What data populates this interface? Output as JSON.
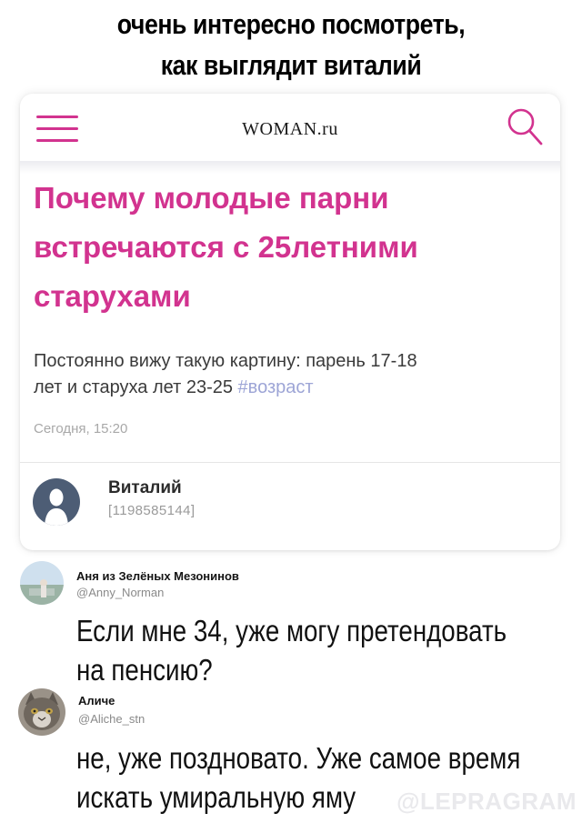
{
  "caption": {
    "line1": "очень интересно посмотреть,",
    "line2": "как выглядит виталий"
  },
  "card": {
    "logo": "WOMAN.ru",
    "headline_lines": [
      "Почему молодые парни",
      "встречаются с 25летними",
      "старухами"
    ],
    "excerpt_line1": "Постоянно вижу такую картину: парень 17-18",
    "excerpt_line2": "лет и старуха лет 23-25 ",
    "hashtag": "#возраст",
    "date": "Сегодня, 15:20",
    "author_name": "Виталий",
    "author_id": "[1198585144]",
    "accent_color": "#d2338f",
    "icons": [
      "menu-icon",
      "search-icon",
      "user-silhouette-icon"
    ]
  },
  "tweets": [
    {
      "name": "Аня из Зелёных Мезонинов",
      "handle": "@Anny_Norman",
      "text_lines": [
        "Если мне 34, уже могу претендовать",
        "на пенсию?"
      ]
    },
    {
      "name": "Аличе",
      "handle": "@Aliche_stn",
      "text_lines": [
        "не, уже поздновато. Уже самое время",
        "искать умиральную яму"
      ]
    }
  ],
  "watermark": "@LEPRAGRAM"
}
